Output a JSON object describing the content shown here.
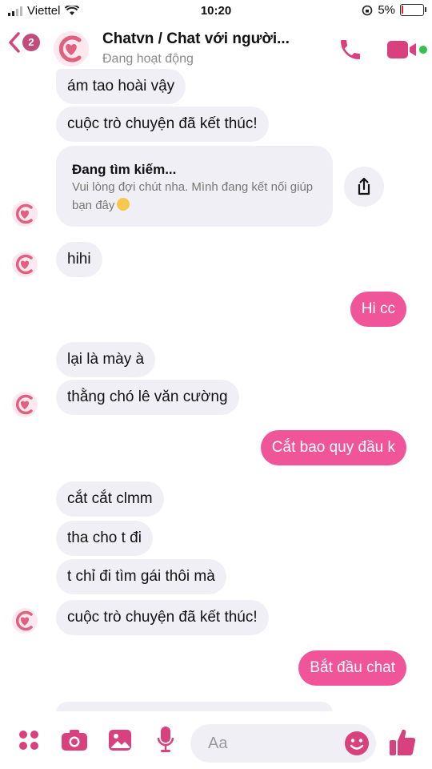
{
  "status_bar": {
    "carrier": "Viettel",
    "time": "10:20",
    "battery": "5%"
  },
  "header": {
    "back_badge": "2",
    "title": "Chatvn / Chat với người...",
    "status": "Đang hoạt động"
  },
  "card": {
    "title": "Đang tìm kiếm...",
    "description": "Vui lòng đợi chút nha. Mình đang kết nối giúp bạn đây"
  },
  "messages": [
    "ám tao  hoài vậy",
    "cuộc trò chuyện đã kết thúc!",
    "hihi",
    "Hi cc",
    "lại là mày à",
    "thằng chó lê văn cường",
    "Cắt bao quy đầu k",
    "cắt cắt clmm",
    "tha cho t đi",
    "t chỉ đi tìm gái thôi mà",
    "cuộc trò chuyện đã kết thúc!",
    "Bắt đầu chat"
  ],
  "composer": {
    "placeholder": "Aa"
  },
  "colors": {
    "accent": "#f0559a",
    "icon": "#d9407e",
    "bubble_in": "#f0eff5",
    "online": "#31c24d"
  }
}
